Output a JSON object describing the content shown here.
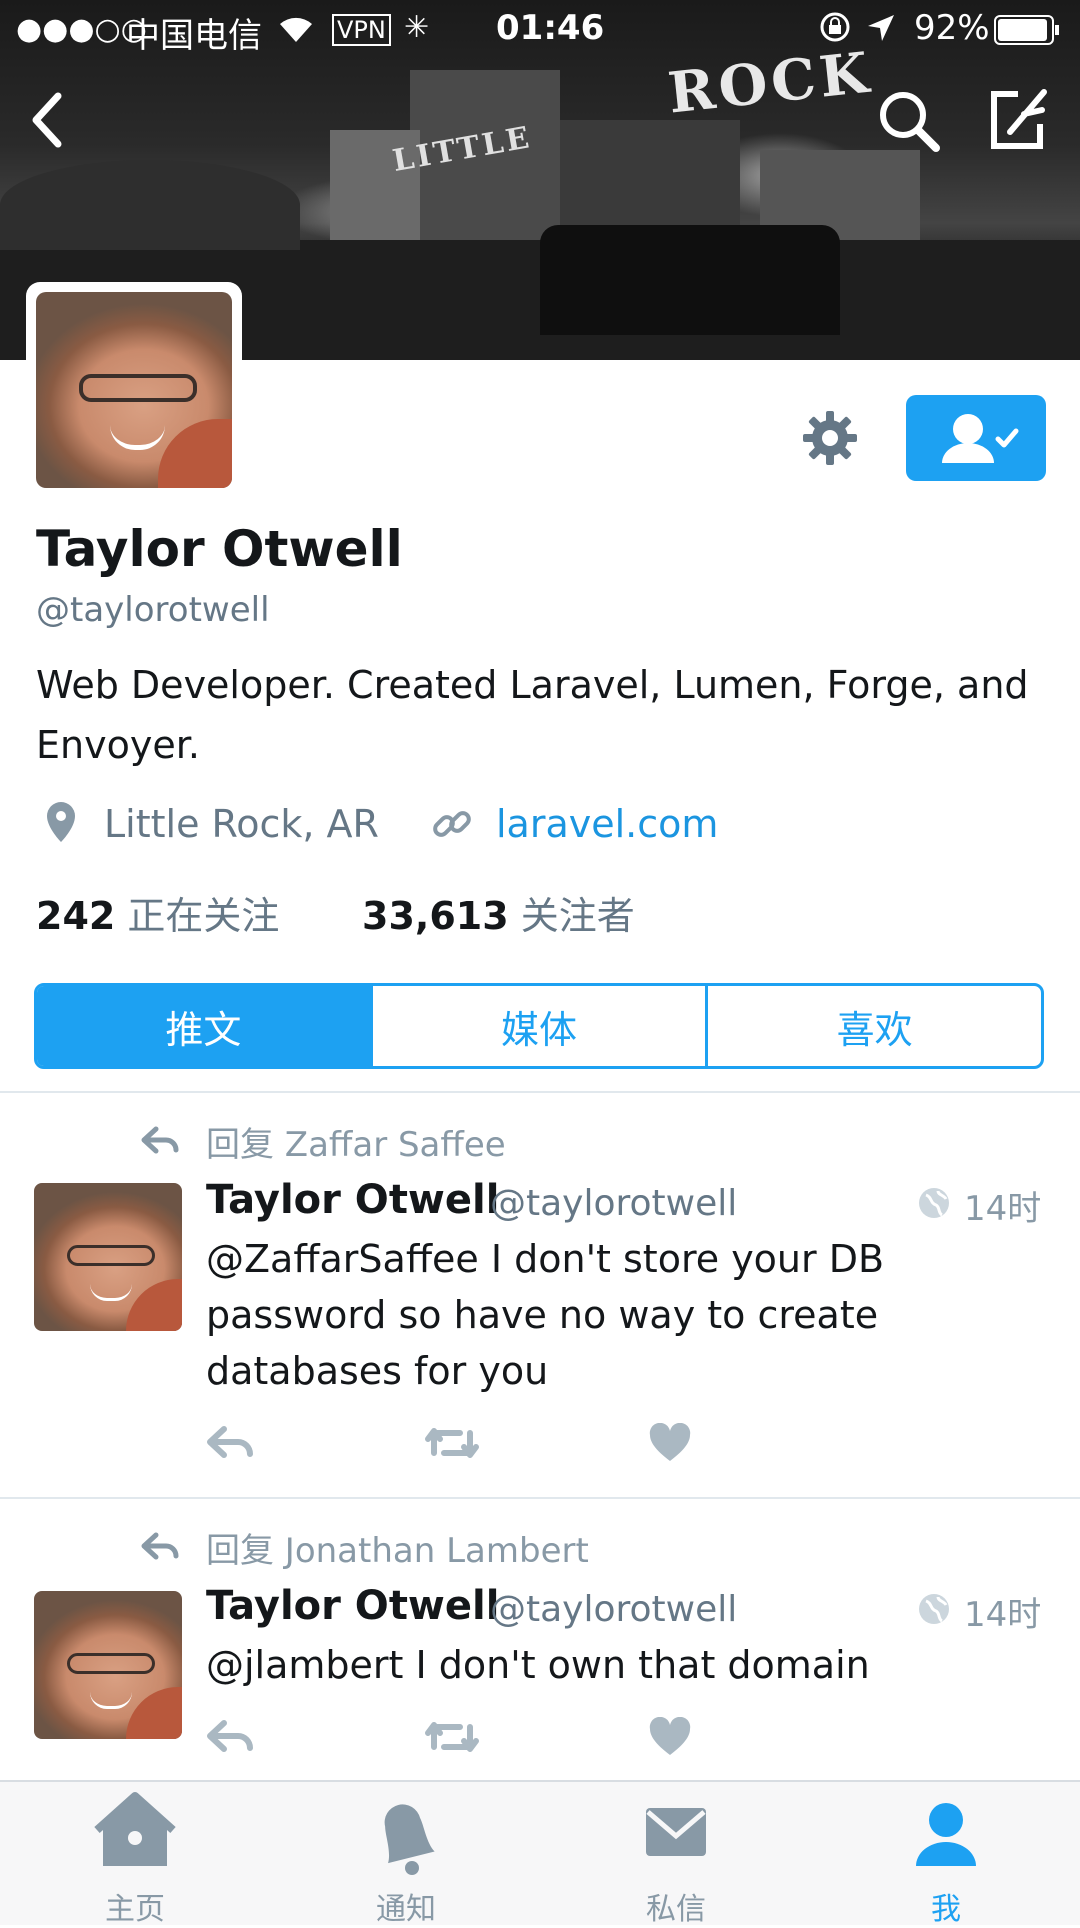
{
  "status_bar": {
    "signal": "●●●○○",
    "carrier": "中国电信",
    "vpn": "VPN",
    "time": "01:46",
    "battery": "92%"
  },
  "header_sign": {
    "rock": "ROCK",
    "little": "LITTLE"
  },
  "profile": {
    "name": "Taylor Otwell",
    "handle": "@taylorotwell",
    "bio": "Web Developer. Created Laravel, Lumen, Forge, and Envoyer.",
    "location": "Little Rock, AR",
    "website": "laravel.com",
    "following_count": "242",
    "following_label": "正在关注",
    "followers_count": "33,613",
    "followers_label": "关注者"
  },
  "tabs": [
    {
      "label": "推文",
      "selected": true
    },
    {
      "label": "媒体",
      "selected": false
    },
    {
      "label": "喜欢",
      "selected": false
    }
  ],
  "tweets": [
    {
      "reply_to": "回复 Zaffar Saffee",
      "name": "Taylor Otwell",
      "handle": "@taylorotwell",
      "time": "14时",
      "text": "@ZaffarSaffee I don't store your DB password so have no way to create databases for you"
    },
    {
      "reply_to": "回复 Jonathan Lambert",
      "name": "Taylor Otwell",
      "handle": "@taylorotwell",
      "time": "14时",
      "text": "@jlambert I don't own that domain"
    }
  ],
  "tab_bar": [
    {
      "label": "主页",
      "icon": "home-icon",
      "active": false
    },
    {
      "label": "通知",
      "icon": "bell-icon",
      "active": false
    },
    {
      "label": "私信",
      "icon": "mail-icon",
      "active": false
    },
    {
      "label": "我",
      "icon": "person-icon",
      "active": true
    }
  ],
  "colors": {
    "accent": "#1da1f2",
    "muted": "#657786",
    "text": "#14171a"
  }
}
